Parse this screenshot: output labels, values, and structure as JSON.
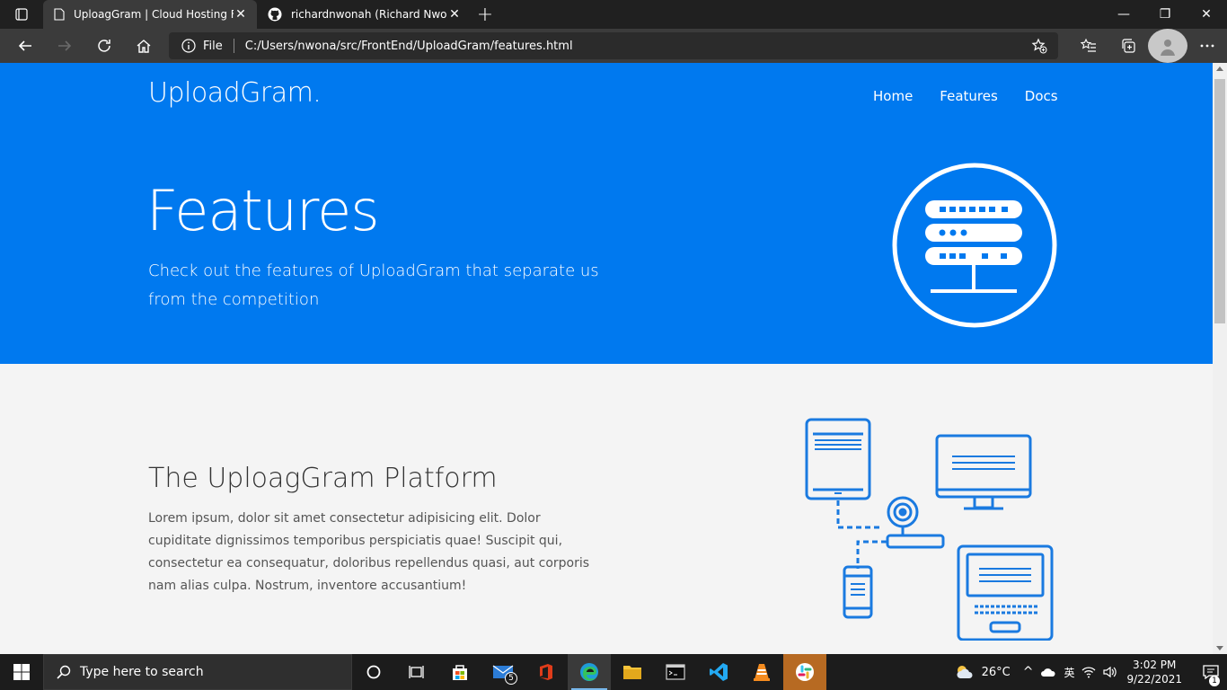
{
  "browser": {
    "tabs": [
      {
        "title": "UploagGram | Cloud Hosting For",
        "active": true
      },
      {
        "title": "richardnwonah (Richard Nwonah",
        "active": false
      }
    ],
    "address": {
      "scheme_label": "File",
      "url": "C:/Users/nwona/src/FrontEnd/UploadGram/features.html"
    }
  },
  "page": {
    "logo": "UploadGram.",
    "nav": [
      "Home",
      "Features",
      "Docs"
    ],
    "hero": {
      "title": "Features",
      "subtitle": "Check out the features of UploadGram that separate us from the competition"
    },
    "section": {
      "title": "The UploagGram Platform",
      "body": "Lorem ipsum, dolor sit amet consectetur adipisicing elit. Dolor cupiditate dignissimos temporibus perspiciatis quae! Suscipit qui, consectetur ea consequatur, doloribus repellendus quasi, aut corporis nam alias culpa. Nostrum, inventore accusantium!"
    },
    "colors": {
      "hero_bg": "#0079ef",
      "icon_stroke": "#1a7ae0"
    }
  },
  "taskbar": {
    "search_placeholder": "Type here to search",
    "mail_count": "5",
    "weather": "26°C",
    "time": "3:02 PM",
    "date": "9/22/2021",
    "notification_count": "1",
    "ime": "英"
  }
}
